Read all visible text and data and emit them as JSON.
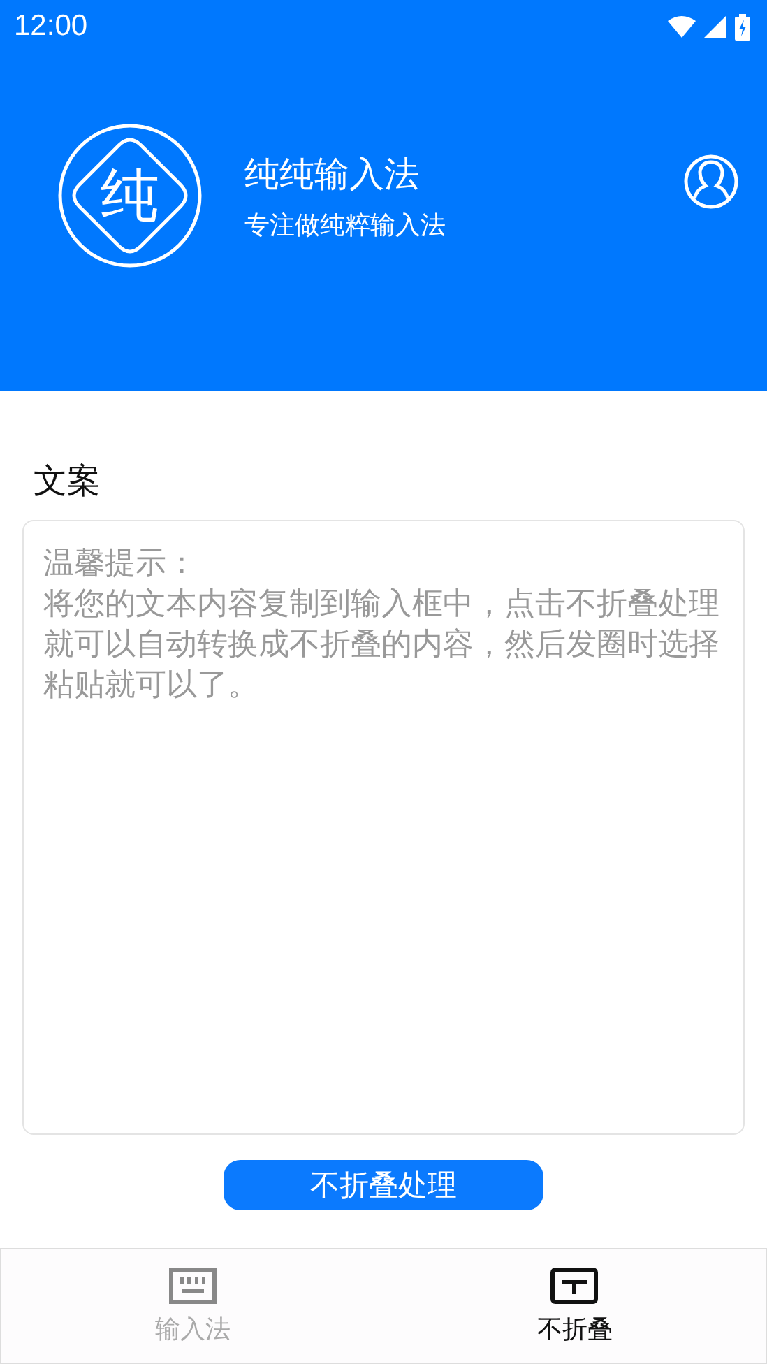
{
  "status_bar": {
    "time": "12:00"
  },
  "header": {
    "logo_char": "纯",
    "title": "纯纯输入法",
    "subtitle": "专注做纯粹输入法"
  },
  "section": {
    "label": "文案"
  },
  "text_field": {
    "hint_title": "温馨提示：",
    "hint": "将您的文本内容复制到输入框中，点击不折叠处理就可以自动转换成不折叠的内容，然后发圈时选择粘贴就可以了。"
  },
  "button": {
    "label": "不折叠处理"
  },
  "tabs": [
    {
      "label": "输入法",
      "kind": "keyboard",
      "selected": false
    },
    {
      "label": "不折叠",
      "kind": "text",
      "selected": true
    }
  ]
}
